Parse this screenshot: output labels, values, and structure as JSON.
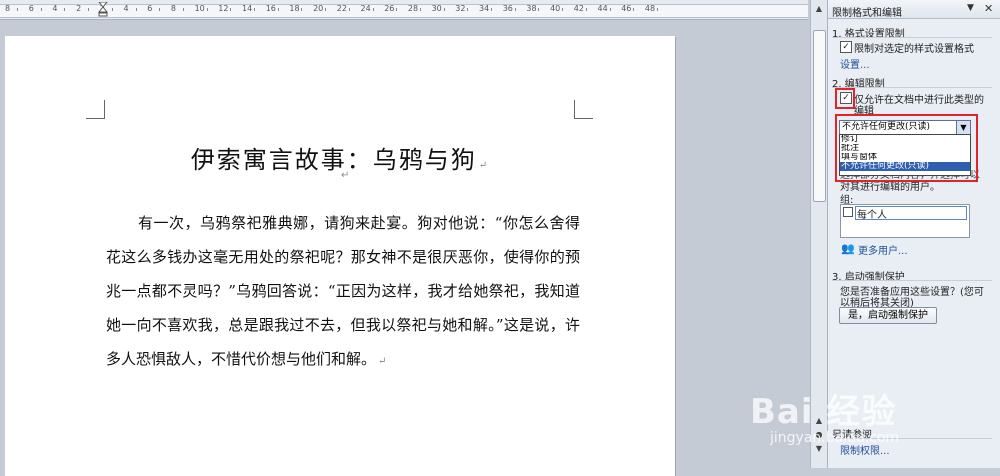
{
  "ruler": {
    "labels": [
      "8",
      "6",
      "4",
      "2",
      "2",
      "4",
      "6",
      "8",
      "10",
      "12",
      "14",
      "16",
      "18",
      "20",
      "22",
      "24",
      "26",
      "28",
      "30",
      "32",
      "34",
      "36",
      "38",
      "40",
      "42",
      "44",
      "46",
      "48"
    ]
  },
  "document": {
    "title": "伊索寓言故事：乌鸦与狗",
    "paragraph_mark": "↵",
    "body": "有一次，乌鸦祭祀雅典娜，请狗来赴宴。狗对他说：“你怎么舍得花这么多钱办这毫无用处的祭祀呢？那女神不是很厌恶你，使得你的预兆一点都不灵吗？”乌鸦回答说：“正因为这样，我才给她祭祀，我知道她一向不喜欢我，总是跟我过不去，但我以祭祀与她和解。”这是说，许多人恐惧敌人，不惜代价想与他们和解。"
  },
  "pane": {
    "title": "限制格式和编辑",
    "menu_arrow": "▼",
    "close": "✕",
    "section1": {
      "heading": "1. 格式设置限制",
      "checkbox_label": "限制对选定的样式设置格式",
      "checked": true,
      "settings_link": "设置..."
    },
    "section2": {
      "heading": "2. 编辑限制",
      "checkbox_label_line1": "仅允许在文档中进行此类型的",
      "checkbox_label_line2": "编辑",
      "checked": true,
      "selected_value": "不允许任何更改(只读)",
      "options": [
        "修订",
        "批注",
        "填写窗体",
        "不允许任何更改(只读)"
      ],
      "exceptions_text_line1": "选择部分文档内容，并选择可以",
      "exceptions_text_line2": "对其进行编辑的用户。",
      "group_label": "组:",
      "group_item": "每个人",
      "more_users_link": "更多用户..."
    },
    "section3": {
      "heading": "3. 启动强制保护",
      "question_line1": "您是否准备应用这些设置？(您可",
      "question_line2": "以稍后将其关闭)",
      "button_label": "是，启动强制保护"
    },
    "footer": {
      "heading": "另请参阅",
      "link": "限制权限..."
    }
  },
  "watermark": {
    "brand": "Bai 经验",
    "url": "jingyan.baidu.com"
  },
  "colors": {
    "highlight_red": "#e0242c",
    "selected_option": "#2f5fb0",
    "link": "#1f4f9a"
  }
}
